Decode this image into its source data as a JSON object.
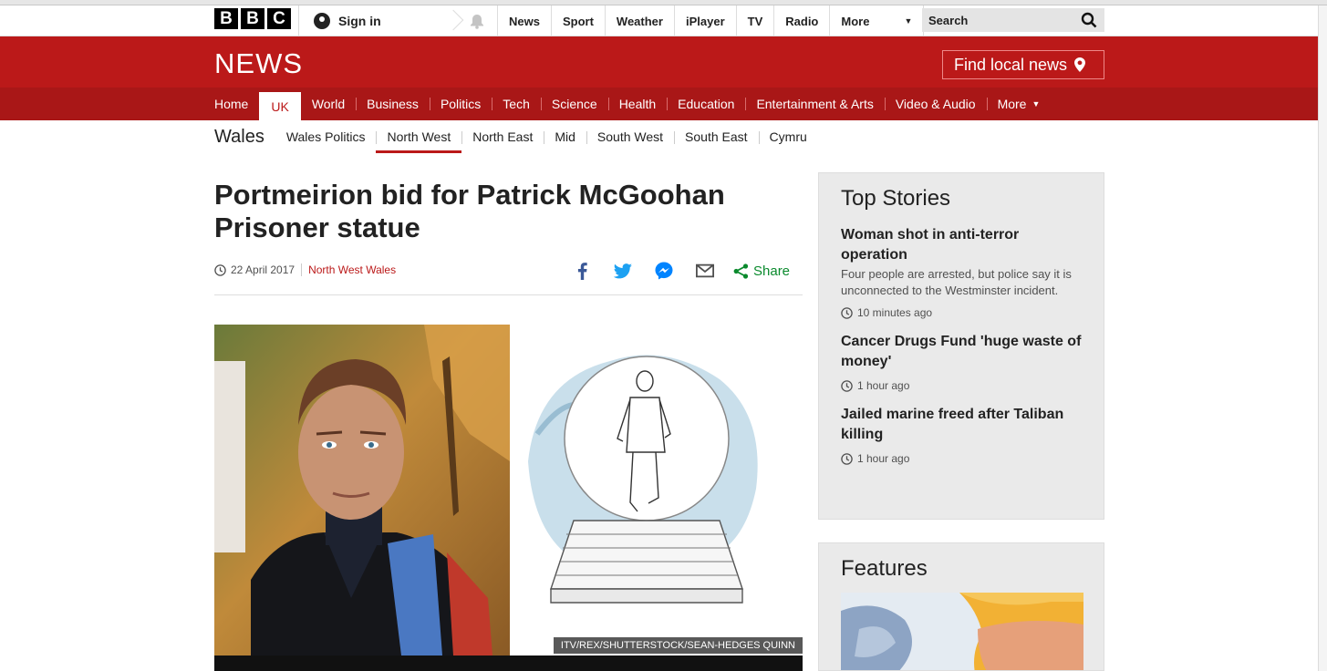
{
  "global_bar": {
    "logo_letters": [
      "B",
      "B",
      "C"
    ],
    "sign_in_label": "Sign in",
    "nav_items": [
      "News",
      "Sport",
      "Weather",
      "iPlayer",
      "TV",
      "Radio"
    ],
    "more_label": "More",
    "search_placeholder": "Search"
  },
  "masthead": {
    "logo_text": "NEWS",
    "local_news_label": "Find local news"
  },
  "primary_nav": {
    "items": [
      "Home",
      "UK",
      "World",
      "Business",
      "Politics",
      "Tech",
      "Science",
      "Health",
      "Education",
      "Entertainment & Arts",
      "Video & Audio",
      "More"
    ],
    "active": "UK"
  },
  "secondary_nav": {
    "section_title": "Wales",
    "items": [
      "Wales Politics",
      "North West",
      "North East",
      "Mid",
      "South West",
      "South East",
      "Cymru"
    ],
    "current": "North West"
  },
  "article": {
    "headline": "Portmeirion bid for Patrick McGoohan Prisoner statue",
    "date": "22 April 2017",
    "section": "North West Wales",
    "share_label": "Share",
    "image_credit": "ITV/REX/SHUTTERSTOCK/SEAN-HEDGES QUINN"
  },
  "sidebar": {
    "top_stories_title": "Top Stories",
    "stories": [
      {
        "title": "Woman shot in anti-terror operation",
        "summary": "Four people are arrested, but police say it is unconnected to the Westminster incident.",
        "time": "10 minutes ago"
      },
      {
        "title": "Cancer Drugs Fund 'huge waste of money'",
        "summary": "",
        "time": "1 hour ago"
      },
      {
        "title": "Jailed marine freed after Taliban killing",
        "summary": "",
        "time": "1 hour ago"
      }
    ],
    "features_title": "Features"
  },
  "colors": {
    "bbc_red": "#bb1919",
    "nav_red": "#a91717",
    "share_green": "#0a8a2d",
    "facebook_blue": "#3b5998",
    "twitter_blue": "#1da1f2",
    "messenger_blue": "#0084ff"
  },
  "icons": [
    "avatar-icon",
    "bell-icon",
    "caret-down-icon",
    "search-icon",
    "map-pin-icon",
    "clock-icon",
    "facebook-icon",
    "twitter-icon",
    "messenger-icon",
    "email-icon",
    "share-icon"
  ]
}
